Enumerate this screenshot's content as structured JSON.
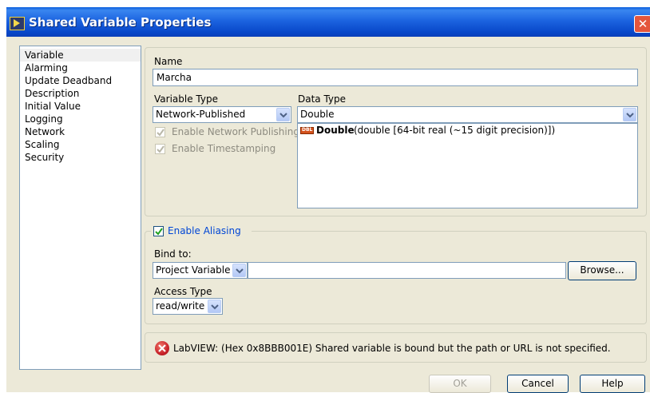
{
  "window": {
    "title": "Shared Variable Properties",
    "close_glyph": "✕"
  },
  "sidebar": {
    "items": [
      {
        "label": "Variable"
      },
      {
        "label": "Alarming"
      },
      {
        "label": "Update Deadband"
      },
      {
        "label": "Description"
      },
      {
        "label": "Initial Value"
      },
      {
        "label": "Logging"
      },
      {
        "label": "Network"
      },
      {
        "label": "Scaling"
      },
      {
        "label": "Security"
      }
    ],
    "selected": "Variable"
  },
  "variable": {
    "name_label": "Name",
    "name_value": "Marcha",
    "variable_type_label": "Variable Type",
    "variable_type_value": "Network-Published",
    "data_type_label": "Data Type",
    "data_type_value": "Double",
    "enable_network_publishing_label": "Enable Network Publishing",
    "enable_network_publishing_checked": true,
    "enable_timestamping_label": "Enable Timestamping",
    "enable_timestamping_checked": true,
    "data_type_list": [
      {
        "icon_text": "DBL",
        "name": "Double",
        "desc": "(double [64-bit real (~15 digit precision)])"
      }
    ]
  },
  "aliasing": {
    "enable_label": "Enable Aliasing",
    "enable_checked": true,
    "bind_to_label": "Bind to:",
    "bind_to_value": "Project Variable",
    "path_value": "",
    "browse_label": "Browse...",
    "access_type_label": "Access Type",
    "access_type_value": "read/write"
  },
  "error": {
    "message": "LabVIEW:  (Hex 0x8BBB001E) Shared variable is bound but the path or URL is not specified."
  },
  "footer": {
    "ok_label": "OK",
    "cancel_label": "Cancel",
    "help_label": "Help"
  },
  "colors": {
    "accent_blue": "#0a5fdc",
    "group_title_blue": "#0046d5",
    "error_red": "#c8232a"
  }
}
